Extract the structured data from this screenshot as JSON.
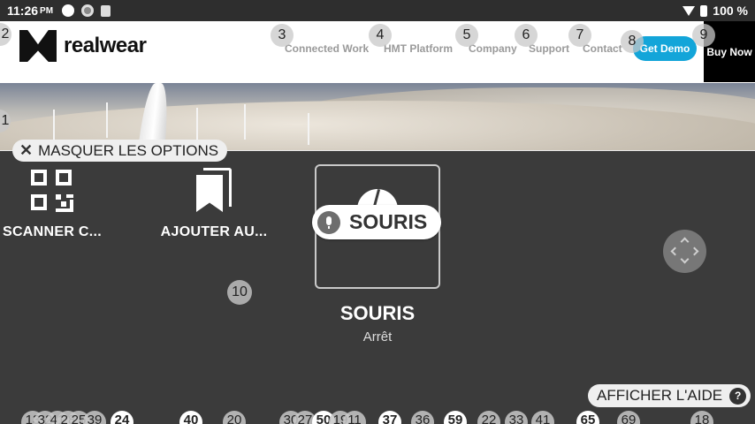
{
  "status_bar": {
    "time": "11:26",
    "ampm": "PM",
    "battery": "100 %",
    "icons": [
      "circle-icon",
      "ring-icon",
      "sd-card-icon",
      "wifi-icon",
      "battery-icon"
    ]
  },
  "site": {
    "logo_text": "realwear",
    "nav": [
      "Connected Work",
      "HMT Platform",
      "Company",
      "Support",
      "Contact"
    ],
    "get_demo": "Get Demo",
    "buy_now": "Buy Now",
    "nav_markers": [
      "3",
      "4",
      "5",
      "6",
      "7",
      "8",
      "9"
    ],
    "edge_markers": [
      "2",
      "1"
    ]
  },
  "overlay": {
    "hide_options": "MASQUER LES OPTIONS",
    "tiles": [
      {
        "label": "SCANNER C...",
        "icon": "qr-code-icon"
      },
      {
        "label": "AJOUTER AU...",
        "icon": "bookmark-icon"
      }
    ],
    "voice_command": "SOURIS",
    "mouse_title": "SOURIS",
    "mouse_status": "Arrêt",
    "marker_10": "10",
    "show_help": "AFFICHER L'AIDE",
    "help_glyph": "?"
  },
  "bottom_markers": [
    "13",
    "32",
    "41",
    "28",
    "25",
    "39",
    "24",
    "40",
    "20",
    "30",
    "27",
    "50",
    "19",
    "11",
    "37",
    "36",
    "59",
    "22",
    "33",
    "41",
    "65",
    "69",
    "18"
  ]
}
